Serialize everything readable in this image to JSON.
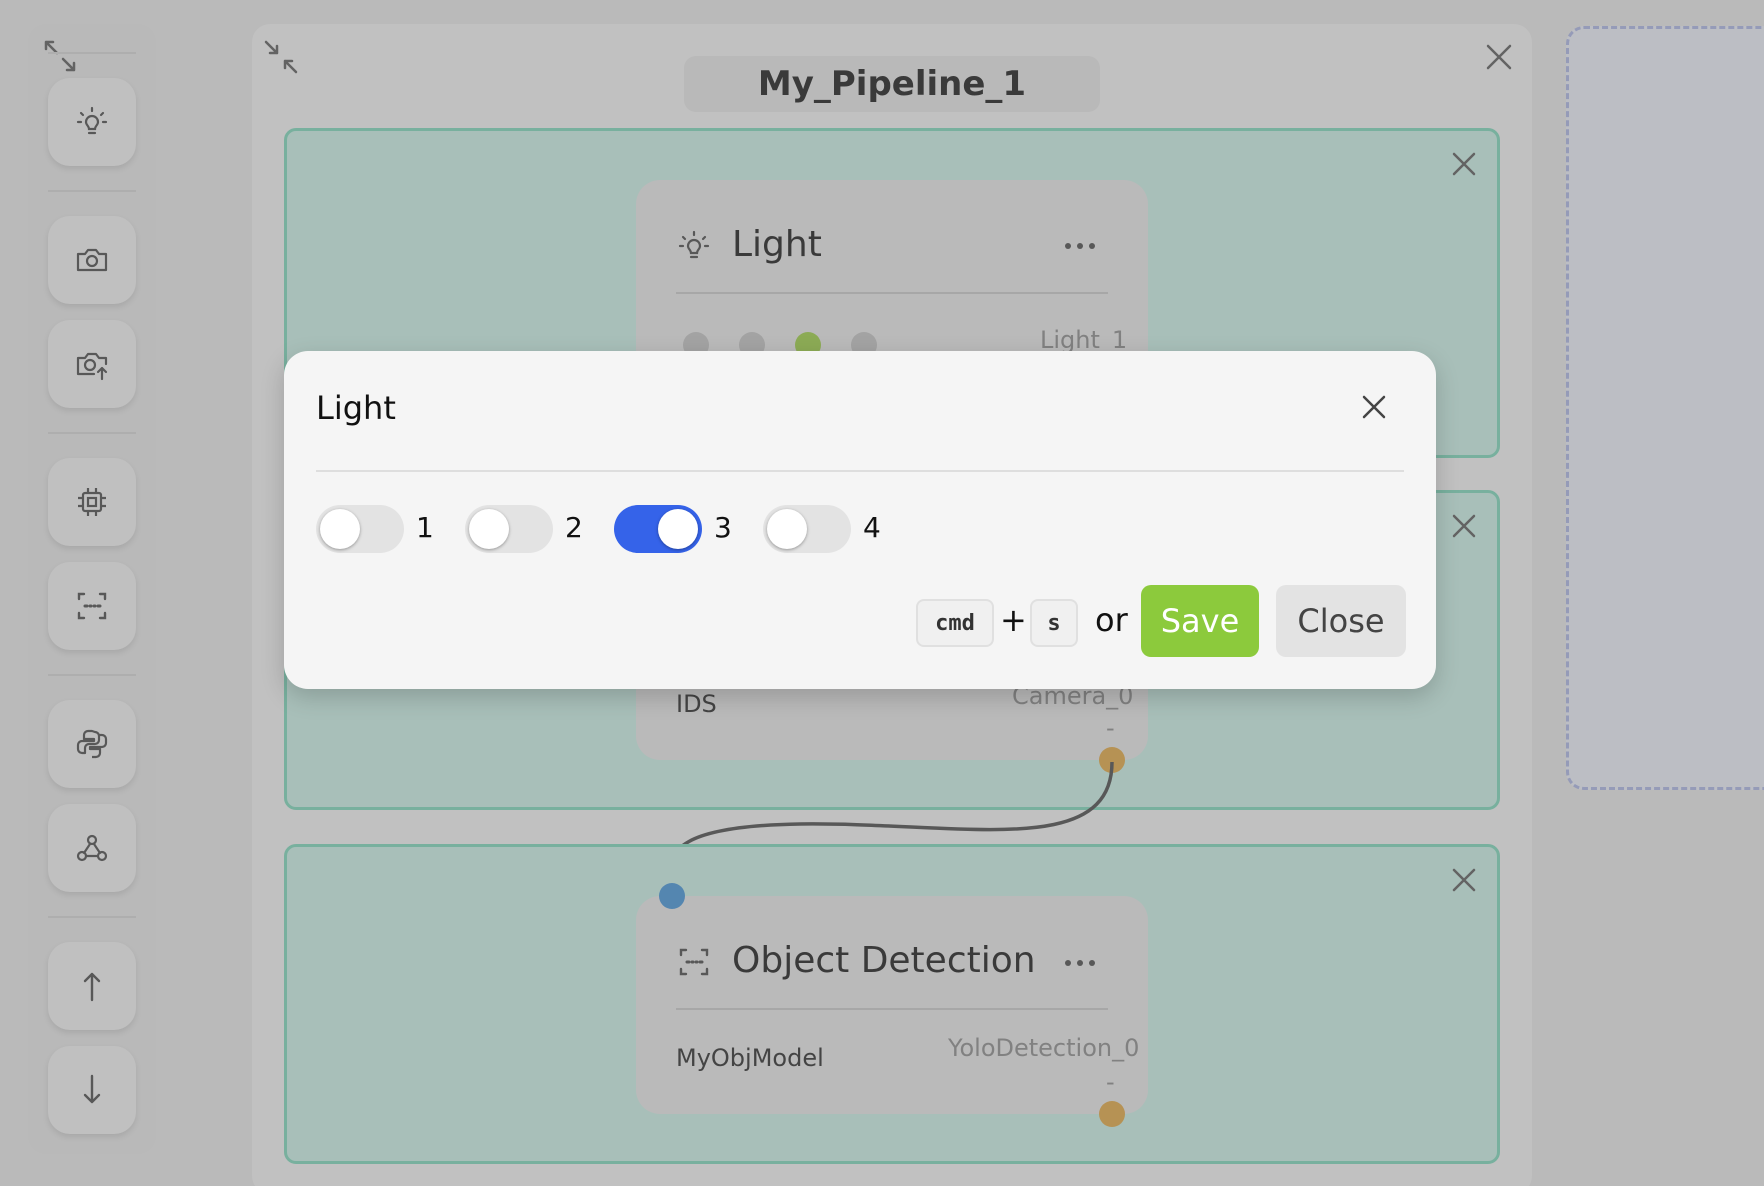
{
  "canvas": {
    "title": "My_Pipeline_1"
  },
  "toolbar": {
    "items": [
      "lightbulb-icon",
      "camera-icon",
      "camera-upload-icon",
      "cpu-chip-icon",
      "scan-icon",
      "python-icon",
      "webhook-icon",
      "arrow-up-icon",
      "arrow-down-icon"
    ]
  },
  "nodes": {
    "light": {
      "title": "Light",
      "instance": "Light_1",
      "active_dot": 3,
      "dot_count": 4
    },
    "camera": {
      "name": "IDS",
      "instance": "Camera_0",
      "dash": "-"
    },
    "detection": {
      "title": "Object Detection",
      "name": "MyObjModel",
      "instance": "YoloDetection_0",
      "dash": "-"
    }
  },
  "modal": {
    "title": "Light",
    "toggles": [
      {
        "label": "1",
        "on": false
      },
      {
        "label": "2",
        "on": false
      },
      {
        "label": "3",
        "on": true
      },
      {
        "label": "4",
        "on": false
      }
    ],
    "shortcut": {
      "mod": "cmd",
      "plus": "+",
      "key": "s",
      "or": "or"
    },
    "save_label": "Save",
    "close_label": "Close"
  },
  "colors": {
    "stage_bg": "#c8efe4",
    "stage_border": "#79d6b7",
    "save": "#8cca3c",
    "toggle_on": "#3563e9",
    "active_dot": "#9acd3f",
    "output_port": "#e0a33c",
    "input_port": "#3d8fd6"
  }
}
